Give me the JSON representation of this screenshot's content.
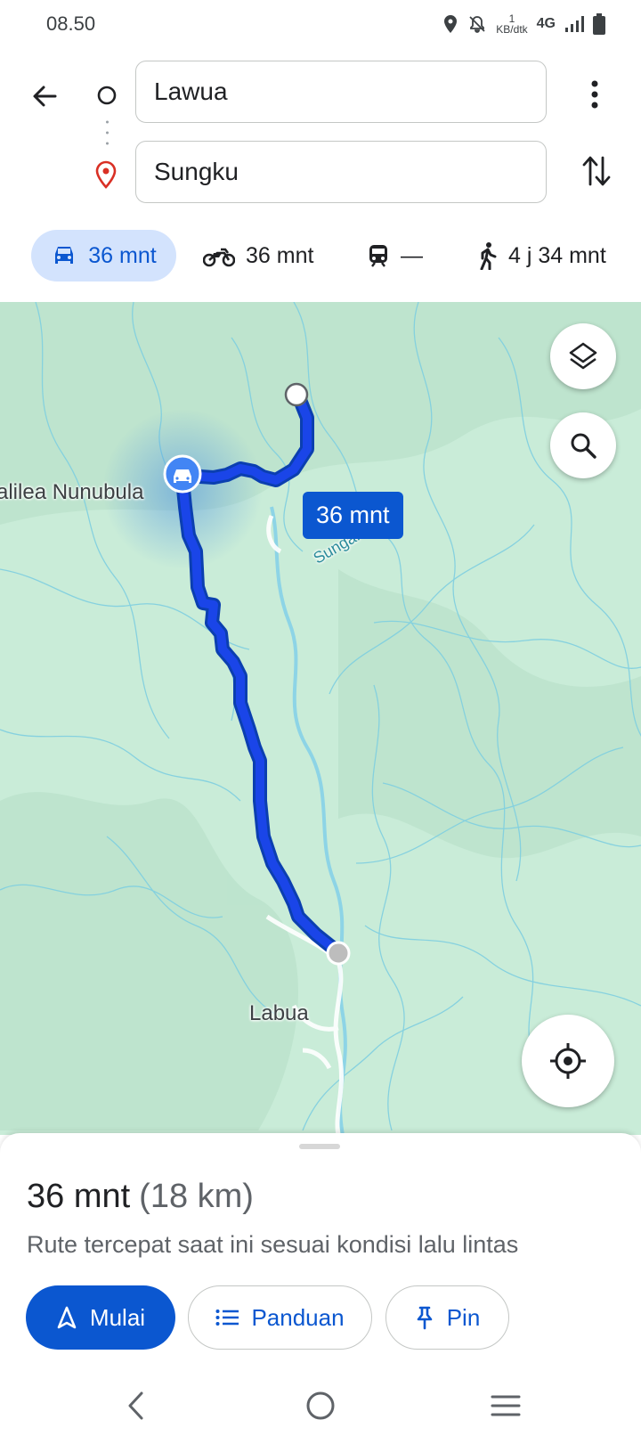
{
  "status_bar": {
    "time": "08.50",
    "speed_value": "1",
    "speed_unit": "KB/dtk",
    "network": "4G",
    "icons": [
      "location-icon",
      "mute-bell-icon",
      "signal-icon",
      "battery-icon"
    ]
  },
  "search": {
    "origin": "Lawua",
    "destination": "Sungku",
    "icons": [
      "back-arrow-icon",
      "origin-circle-icon",
      "destination-pin-icon",
      "more-vert-icon",
      "swap-icon"
    ]
  },
  "modes": [
    {
      "mode": "car",
      "icon": "car-icon",
      "label": "36 mnt",
      "selected": true
    },
    {
      "mode": "motorcycle",
      "icon": "motorcycle-icon",
      "label": "36 mnt",
      "selected": false
    },
    {
      "mode": "transit",
      "icon": "train-icon",
      "label": "—",
      "selected": false
    },
    {
      "mode": "walk",
      "icon": "walk-icon",
      "label": "4 j 34 mnt",
      "selected": false
    }
  ],
  "map": {
    "labels": {
      "nunubula": "alilea Nunubula",
      "labua": "Labua",
      "sungai": "Sungai"
    },
    "route_chip": "36 mnt",
    "route_color": "#0b57d0",
    "land_color": "#c9ecd8"
  },
  "sheet": {
    "duration": "36 mnt",
    "distance": "(18 km)",
    "description": "Rute tercepat saat ini sesuai kondisi lalu lintas",
    "buttons": {
      "start": "Mulai",
      "guide": "Panduan",
      "pin": "Pin"
    }
  },
  "colors": {
    "accent": "#0b57d0",
    "accent_light": "#d3e3fd",
    "pin_red": "#d93025"
  }
}
